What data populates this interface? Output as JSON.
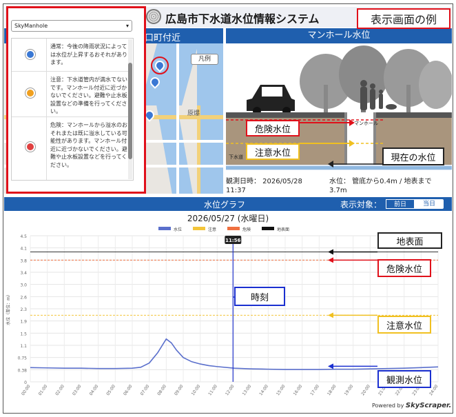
{
  "app": {
    "title": "広島市下水道水位情報システム",
    "example_label": "表示画面の例"
  },
  "map": {
    "header_suffix": "口町付近",
    "legend_button": "凡例",
    "place_label": "原爆"
  },
  "panel": {
    "select_value": "SkyManhole",
    "items": [
      {
        "color": "#3a78d4",
        "text": "通常：今後の降雨状況によっては水位が上昇するおそれがあります。"
      },
      {
        "color": "#f0a020",
        "text": "注意：下水道管内が満水でないです。マンホール付近に近づかないでください。避難や止水板設置などの準備を行ってください。"
      },
      {
        "color": "#e04040",
        "text": "危険：マンホールから溢水のおそれまたは既に溢水している可能性があります。マンホール付近に近づかないでください。避難や止水板設置などを行ってください。"
      }
    ]
  },
  "manhole": {
    "header": "マンホール水位",
    "manhole_label": "マンホール",
    "pipe_label": "下水道",
    "observed_line1": "観測日時： 2026/05/28",
    "observed_line2": "11:37",
    "level_line1": "水位： 管底から0.4m / 地表まで",
    "level_line2": "3.7m"
  },
  "callouts": {
    "danger": "危険水位",
    "caution": "注意水位",
    "current": "現在の水位",
    "ground": "地表面",
    "danger2": "危険水位",
    "time": "時刻",
    "caution2": "注意水位",
    "observed": "観測水位"
  },
  "graph": {
    "header": "水位グラフ",
    "target_label": "表示対象：",
    "prev_day": "前日",
    "today": "当日",
    "date": "2026/05/27 (水曜日)",
    "legend": [
      {
        "name": "水位",
        "color": "#5a6fcc"
      },
      {
        "name": "注意",
        "color": "#f3c53a"
      },
      {
        "name": "危険",
        "color": "#f07040"
      },
      {
        "name": "地表面",
        "color": "#111111"
      }
    ],
    "cursor_label": "11:56"
  },
  "chart_data": {
    "type": "line",
    "ylabel": "水位（単位：m）",
    "ylim": [
      0,
      4.5
    ],
    "yticks": [
      "0",
      "0.38",
      "0.75",
      "1.1",
      "1.5",
      "1.9",
      "2.3",
      "2.6",
      "3.0",
      "3.4",
      "3.8",
      "4.1",
      "4.5"
    ],
    "xticks": [
      "00:00",
      "01:00",
      "02:00",
      "03:00",
      "04:00",
      "05:00",
      "06:00",
      "07:00",
      "08:00",
      "09:00",
      "10:00",
      "11:00",
      "12:00",
      "13:00",
      "14:00",
      "15:00",
      "16:00",
      "17:00",
      "18:00",
      "19:00",
      "20:00",
      "21:00",
      "22:00",
      "23:00",
      "24:00"
    ],
    "xlim": [
      0,
      24
    ],
    "ground_level": 4.0,
    "danger_level": 3.75,
    "caution_level": 2.05,
    "cursor_hour": 11.93,
    "series": [
      {
        "name": "水位",
        "color": "#5a6fcc",
        "x": [
          0,
          1,
          2,
          3,
          4,
          5,
          6,
          6.5,
          7,
          7.5,
          8,
          8.3,
          8.6,
          9,
          9.5,
          10,
          10.5,
          11,
          12,
          13,
          14,
          15,
          16,
          17,
          18,
          19,
          20,
          21,
          22,
          23,
          24
        ],
        "y": [
          0.44,
          0.43,
          0.42,
          0.42,
          0.41,
          0.41,
          0.42,
          0.45,
          0.58,
          0.9,
          1.32,
          1.2,
          0.98,
          0.75,
          0.62,
          0.55,
          0.5,
          0.47,
          0.42,
          0.4,
          0.39,
          0.38,
          0.38,
          0.38,
          0.39,
          0.39,
          0.4,
          0.41,
          0.42,
          0.44,
          0.46
        ]
      }
    ]
  },
  "footer": {
    "powered_prefix": "Powered by",
    "powered_brand": "SkyScraper."
  }
}
